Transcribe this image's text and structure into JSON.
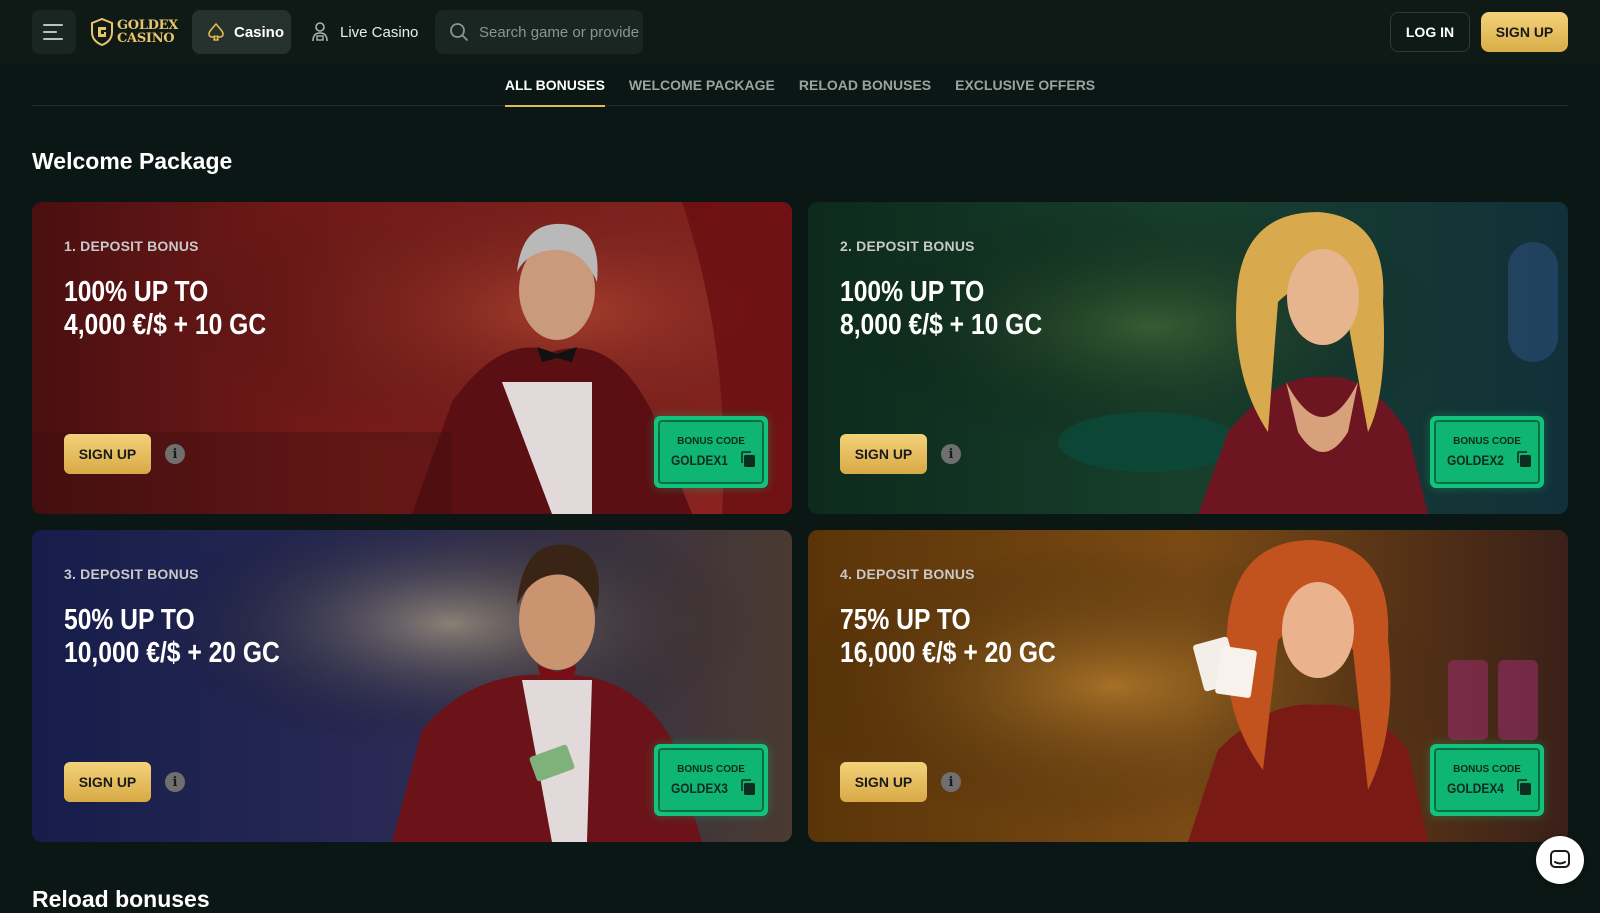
{
  "header": {
    "logo": {
      "line1": "GOLDEX",
      "line2": "CASINO"
    },
    "nav_casino": "Casino",
    "nav_live_casino": "Live Casino",
    "search_placeholder": "Search game or provider",
    "login_label": "LOG IN",
    "signup_label": "SIGN UP"
  },
  "tabs": [
    {
      "label": "ALL BONUSES",
      "active": true
    },
    {
      "label": "WELCOME PACKAGE",
      "active": false
    },
    {
      "label": "RELOAD BONUSES",
      "active": false
    },
    {
      "label": "EXCLUSIVE OFFERS",
      "active": false
    }
  ],
  "section": {
    "title": "Welcome Package",
    "next_title": "Reload bonuses"
  },
  "cards": [
    {
      "label": "1. DEPOSIT BONUS",
      "line1": "100% UP TO",
      "line2": "4,000 €/$ + 10 GC",
      "signup": "SIGN UP",
      "code_label": "BONUS CODE",
      "code": "GOLDEX1",
      "theme": "red"
    },
    {
      "label": "2. DEPOSIT BONUS",
      "line1": "100% UP TO",
      "line2": "8,000 €/$ + 10 GC",
      "signup": "SIGN UP",
      "code_label": "BONUS CODE",
      "code": "GOLDEX2",
      "theme": "green"
    },
    {
      "label": "3. DEPOSIT BONUS",
      "line1": "50% UP TO",
      "line2": "10,000 €/$ + 20 GC",
      "signup": "SIGN UP",
      "code_label": "BONUS CODE",
      "code": "GOLDEX3",
      "theme": "blue"
    },
    {
      "label": "4. DEPOSIT BONUS",
      "line1": "75% UP TO",
      "line2": "16,000 €/$ + 20 GC",
      "signup": "SIGN UP",
      "code_label": "BONUS CODE",
      "code": "GOLDEX4",
      "theme": "gold"
    }
  ],
  "colors": {
    "page_bg": "#0b1714",
    "accent_gold": "#e2b84f",
    "code_green": "#12c37d"
  },
  "icons": {
    "menu": "menu-icon",
    "casino": "spade-icon",
    "live_casino": "dealer-icon",
    "search": "search-icon",
    "info": "info-icon",
    "copy": "copy-icon",
    "chat": "chat-icon"
  }
}
